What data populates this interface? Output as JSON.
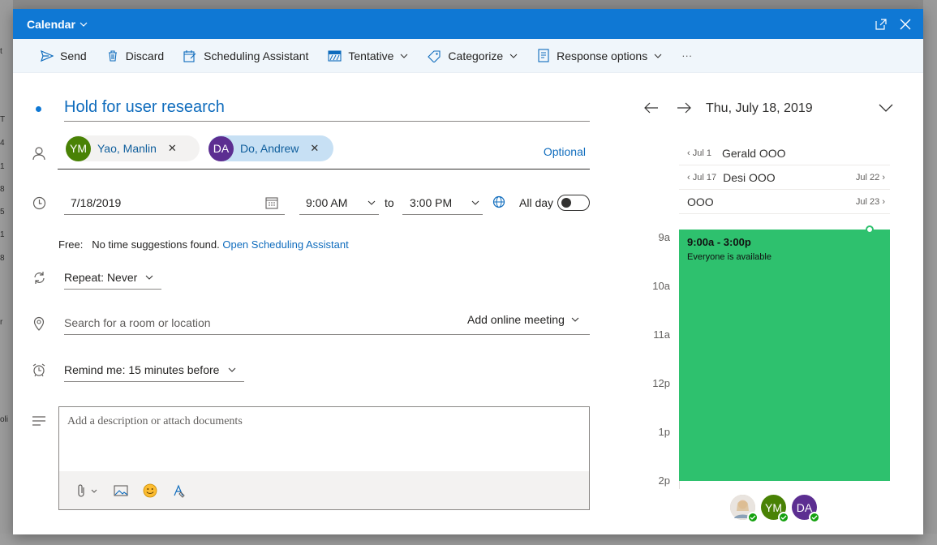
{
  "window": {
    "title": "Calendar"
  },
  "toolbar": {
    "send": "Send",
    "discard": "Discard",
    "scheduling_assistant": "Scheduling Assistant",
    "tentative": "Tentative",
    "categorize": "Categorize",
    "response_options": "Response options",
    "more": "···"
  },
  "event": {
    "title": "Hold for user research"
  },
  "attendees": {
    "people": [
      {
        "initials": "YM",
        "name": "Yao, Manlin",
        "color": "#498205"
      },
      {
        "initials": "DA",
        "name": "Do, Andrew",
        "color": "#5c2e91"
      }
    ],
    "optional_label": "Optional"
  },
  "datetime": {
    "date": "7/18/2019",
    "start": "9:00 AM",
    "to_label": "to",
    "end": "3:00 PM",
    "all_day_label": "All day",
    "all_day": false
  },
  "suggestions": {
    "label": "Free:",
    "text": "No time suggestions found.",
    "link": "Open Scheduling Assistant"
  },
  "repeat": {
    "label": "Repeat:",
    "value": "Never"
  },
  "location": {
    "placeholder": "Search for a room or location",
    "online_meeting": "Add online meeting"
  },
  "reminder": {
    "label": "Remind me:",
    "value": "15 minutes before"
  },
  "description": {
    "placeholder": "Add a description or attach documents"
  },
  "day_view": {
    "date": "Thu, July 18, 2019",
    "all_day_events": [
      {
        "start": "Jul 1",
        "title": "Gerald OOO",
        "end": ""
      },
      {
        "start": "Jul 17",
        "title": "Desi OOO",
        "end": "Jul 22"
      },
      {
        "start": "",
        "title": "OOO",
        "end": "Jul 23"
      }
    ],
    "hours": [
      "9a",
      "10a",
      "11a",
      "12p",
      "1p",
      "2p"
    ],
    "event_time": "9:00a - 3:00p",
    "event_status": "Everyone is available",
    "participants": [
      {
        "initials": "",
        "color": "#c8b8a6"
      },
      {
        "initials": "YM",
        "color": "#498205"
      },
      {
        "initials": "DA",
        "color": "#5c2e91"
      }
    ]
  },
  "colors": {
    "accent": "#0f78d4",
    "event": "#2ec16e"
  }
}
